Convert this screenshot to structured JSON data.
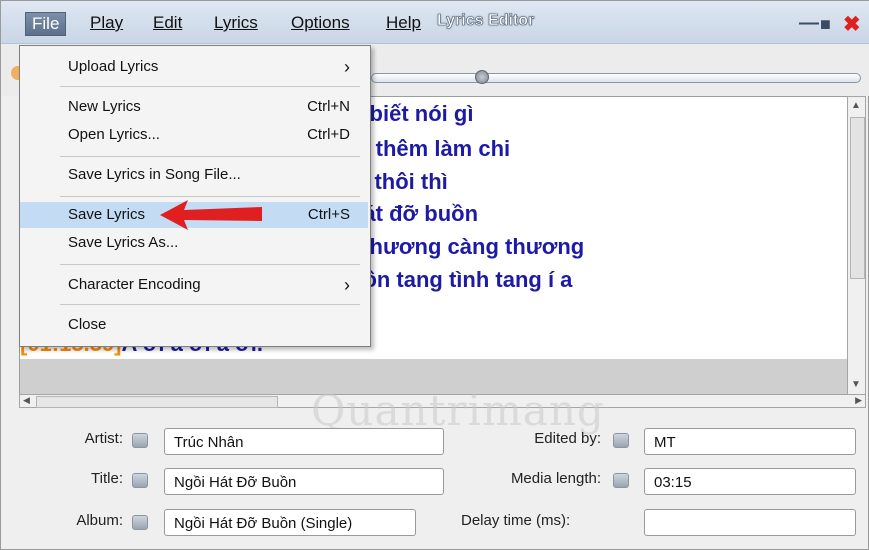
{
  "menubar": {
    "items": [
      {
        "key": "file",
        "label": "File"
      },
      {
        "key": "play",
        "label": "Play"
      },
      {
        "key": "edit",
        "label": "Edit"
      },
      {
        "key": "lyrics",
        "label": "Lyrics"
      },
      {
        "key": "options",
        "label": "Options"
      },
      {
        "key": "help",
        "label": "Help"
      }
    ],
    "app_title": "Lyrics Editor",
    "minimize_glyph": "—",
    "maximize_glyph": "■",
    "close_glyph": "✖"
  },
  "file_menu": {
    "upload_lyrics": "Upload Lyrics",
    "new_lyrics": "New Lyrics",
    "new_lyrics_shortcut": "Ctrl+N",
    "open_lyrics": "Open Lyrics...",
    "open_lyrics_shortcut": "Ctrl+D",
    "save_in_song": "Save Lyrics in Song File...",
    "save_lyrics": "Save Lyrics",
    "save_lyrics_shortcut": "Ctrl+S",
    "save_lyrics_as": "Save Lyrics As...",
    "character_encoding": "Character Encoding",
    "close": "Close",
    "submenu_glyph": "›"
  },
  "lyrics_lines": [
    "g biết nói gì",
    "đi thêm làm chi",
    "ly thôi thì",
    "hát đỡ buồn",
    "i thương càng thương",
    "uồn tang tình tang í a"
  ],
  "last_line": {
    "timestamp": "[01:15.39]",
    "text": "A ơi a ơi a ơi."
  },
  "form": {
    "artist_label": "Artist:",
    "artist_value": "Trúc Nhân",
    "title_label": "Title:",
    "title_value": "Ngồi Hát Đỡ Buồn",
    "album_label": "Album:",
    "album_value": "Ngồi Hát Đỡ Buồn (Single)",
    "edited_by_label": "Edited by:",
    "edited_by_value": "MT",
    "media_length_label": "Media length:",
    "media_length_value": "03:15",
    "delay_label": "Delay time (ms):",
    "delay_value": ""
  },
  "watermark": "Quantrimang",
  "colors": {
    "lyric_text": "#1d1ba6",
    "timestamp": "#ff8c00",
    "highlight": "#c3dcf3",
    "arrow": "#e02020",
    "close_button": "#e02020"
  },
  "icons": [
    "lock-icon",
    "chevron-right-icon",
    "arrow-up-icon",
    "arrow-down-icon",
    "arrow-left-icon",
    "arrow-right-icon"
  ]
}
